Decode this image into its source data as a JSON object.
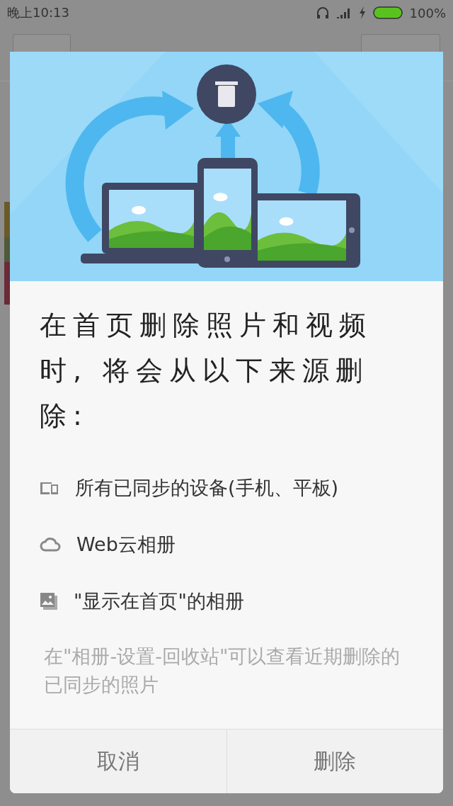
{
  "status_bar": {
    "time": "晚上10:13",
    "battery": "100%"
  },
  "dialog": {
    "title": "在首页删除照片和视频时, 将会从以下来源删除:",
    "sources": [
      {
        "kind": "devices",
        "label": "所有已同步的设备(手机、平板)"
      },
      {
        "kind": "cloud",
        "label": "Web云相册"
      },
      {
        "kind": "album",
        "label": "\"显示在首页\"的相册"
      }
    ],
    "note": "在\"相册-设置-回收站\"可以查看近期删除的已同步的照片",
    "buttons": [
      "取消",
      "删除"
    ]
  }
}
